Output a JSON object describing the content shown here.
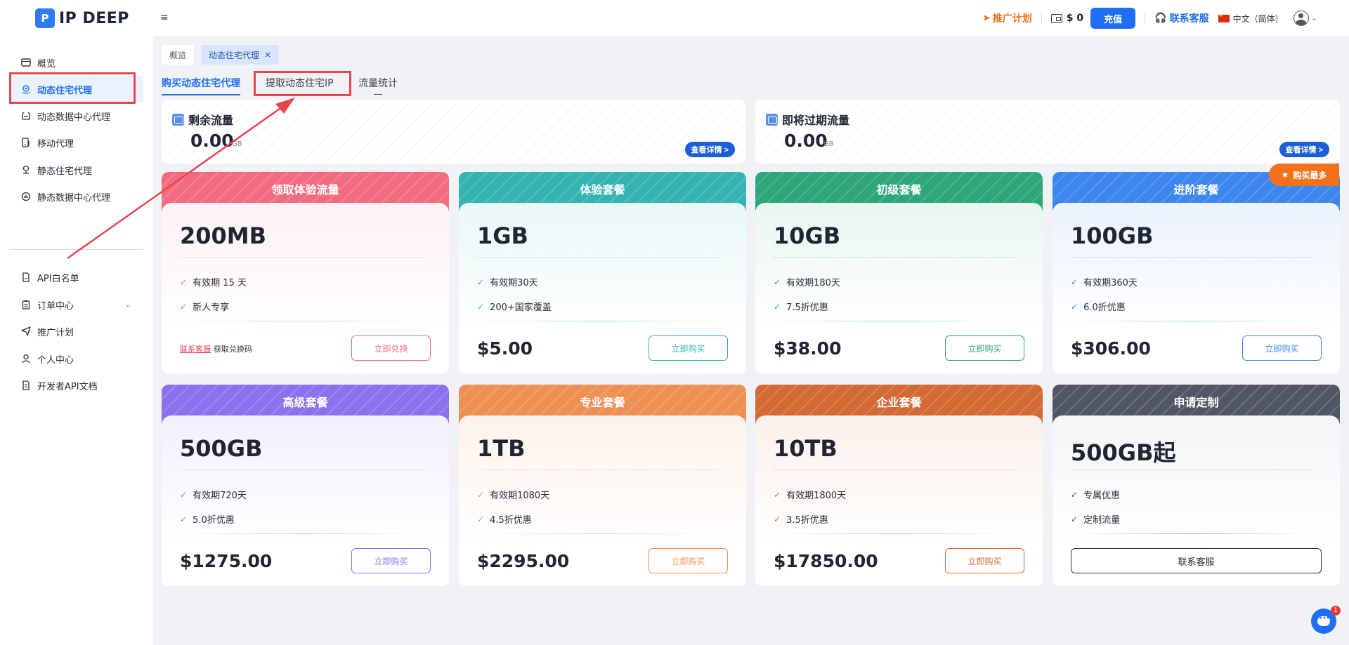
{
  "header": {
    "brand": "IP DEEP",
    "logo_mark": "P",
    "promo": "推广计划",
    "balance": "$ 0",
    "recharge": "充值",
    "support": "联系客服",
    "language": "中文（简体）"
  },
  "sidebar": {
    "items": [
      {
        "label": "概览",
        "icon": "overview-icon"
      },
      {
        "label": "动态住宅代理",
        "icon": "location-icon"
      },
      {
        "label": "动态数据中心代理",
        "icon": "datacenter-icon"
      },
      {
        "label": "移动代理",
        "icon": "mobile-icon"
      },
      {
        "label": "静态住宅代理",
        "icon": "pin-icon"
      },
      {
        "label": "静态数据中心代理",
        "icon": "chart-icon"
      },
      {
        "label": "API白名单",
        "icon": "document-icon"
      },
      {
        "label": "订单中心",
        "icon": "clipboard-icon"
      },
      {
        "label": "推广计划",
        "icon": "send-icon"
      },
      {
        "label": "个人中心",
        "icon": "user-icon"
      },
      {
        "label": "开发者API文档",
        "icon": "file-icon"
      }
    ]
  },
  "tabs": {
    "overview": "概览",
    "active": "动态住宅代理",
    "close": "×"
  },
  "subtabs": [
    "购买动态住宅代理",
    "提取动态住宅IP",
    "流量统计"
  ],
  "flow": {
    "remaining_title": "剩余流量",
    "remaining_value": "0.00",
    "expiring_title": "即将过期流量",
    "expiring_value": "0.00",
    "unit": "GB",
    "details": "查看详情 >"
  },
  "hot_badge": "购买最多",
  "packages": [
    {
      "name": "领取体验流量",
      "size": "200MB",
      "features": [
        "有效期 15 天",
        "新人专享"
      ],
      "price": "",
      "action": "立即兑换",
      "note_link": "联系客服",
      "note": "获取兑换码",
      "color": "#f26b7f"
    },
    {
      "name": "体验套餐",
      "size": "1GB",
      "features": [
        "有效期30天",
        "200+国家覆盖"
      ],
      "price": "$5.00",
      "action": "立即购买",
      "color": "#34b4b1"
    },
    {
      "name": "初级套餐",
      "size": "10GB",
      "features": [
        "有效期180天",
        "7.5折优惠"
      ],
      "price": "$38.00",
      "action": "立即购买",
      "color": "#2fa57a"
    },
    {
      "name": "进阶套餐",
      "size": "100GB",
      "features": [
        "有效期360天",
        "6.0折优惠"
      ],
      "price": "$306.00",
      "action": "立即购买",
      "color": "#3d86ee"
    },
    {
      "name": "高级套餐",
      "size": "500GB",
      "features": [
        "有效期720天",
        "5.0折优惠"
      ],
      "price": "$1275.00",
      "action": "立即购买",
      "color": "#8a72ee"
    },
    {
      "name": "专业套餐",
      "size": "1TB",
      "features": [
        "有效期1080天",
        "4.5折优惠"
      ],
      "price": "$2295.00",
      "action": "立即购买",
      "color": "#ee8f53"
    },
    {
      "name": "企业套餐",
      "size": "10TB",
      "features": [
        "有效期1800天",
        "3.5折优惠"
      ],
      "price": "$17850.00",
      "action": "立即购买",
      "color": "#d36a33"
    },
    {
      "name": "申请定制",
      "size": "500GB起",
      "features": [
        "专属优惠",
        "定制流量"
      ],
      "price": "",
      "action": "联系客服",
      "color": "#505663"
    }
  ],
  "chat_badge": "1"
}
